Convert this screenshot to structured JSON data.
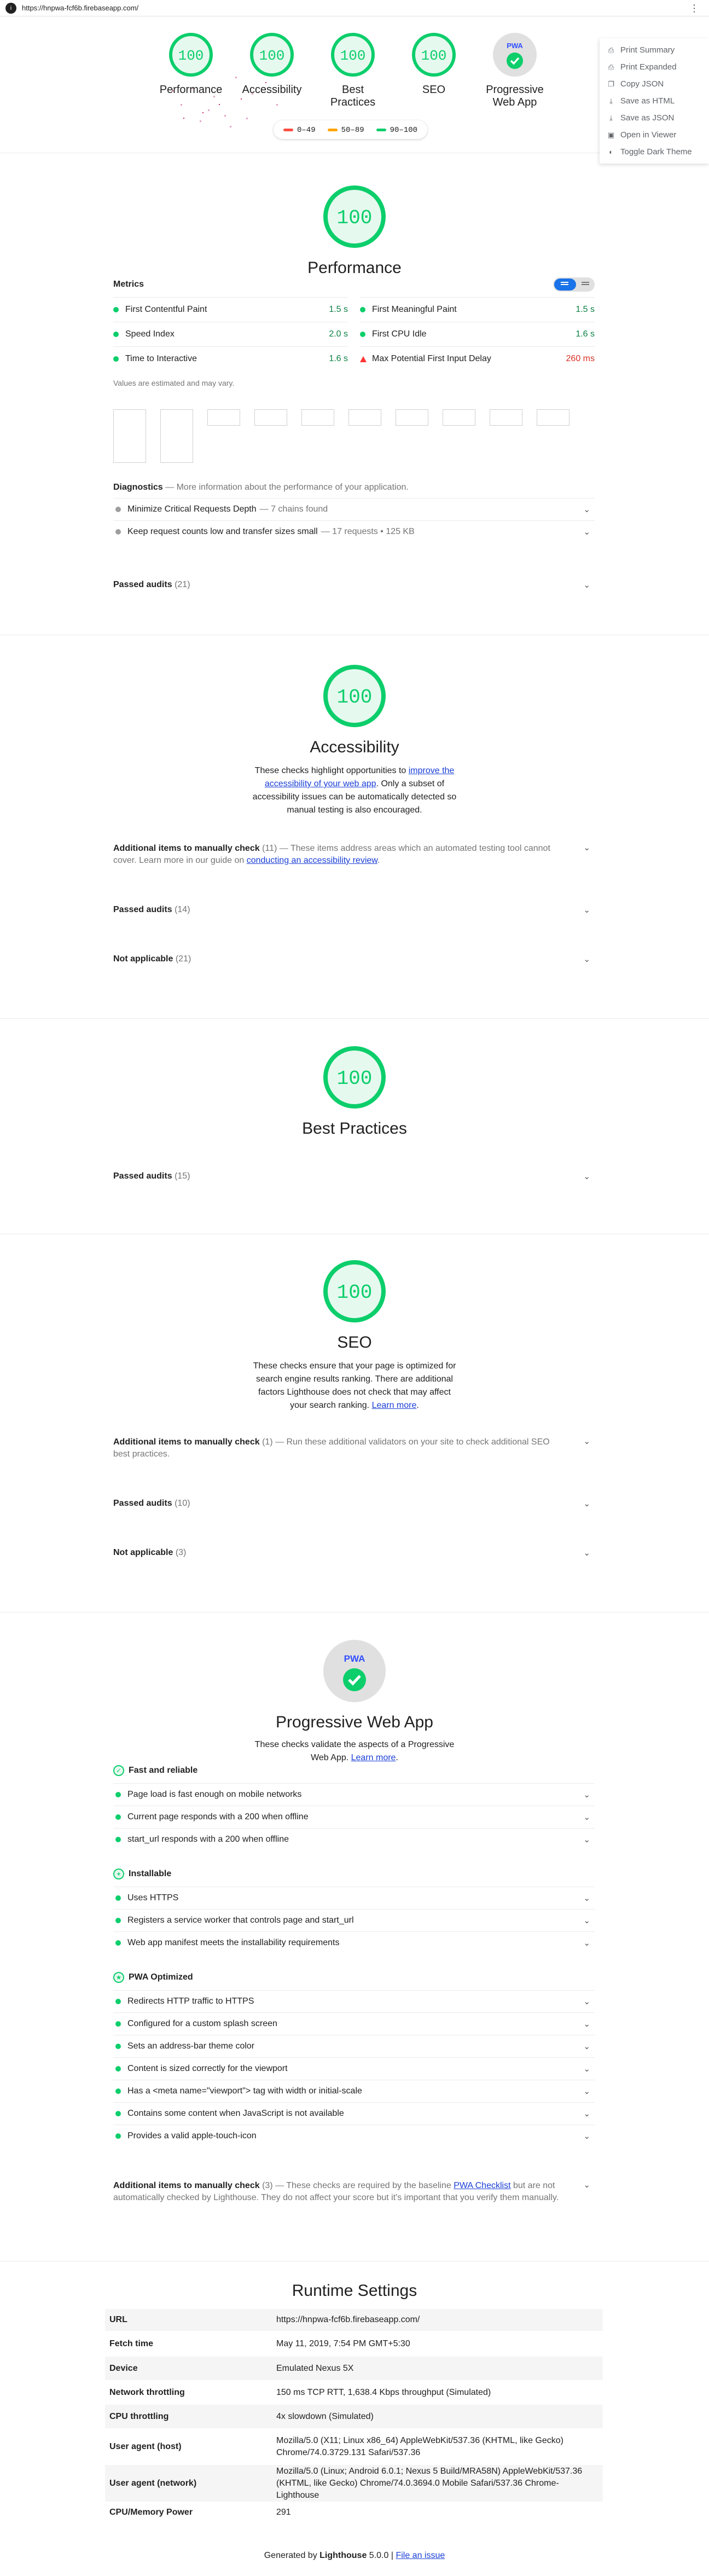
{
  "url_bar": {
    "url": "https://hnpwa-fcf6b.firebaseapp.com/",
    "logo_letter": "i"
  },
  "scores": [
    {
      "label": "Performance",
      "score": "100"
    },
    {
      "label": "Accessibility",
      "score": "100"
    },
    {
      "label": "Best Practices",
      "score": "100"
    },
    {
      "label": "SEO",
      "score": "100"
    },
    {
      "label": "Progressive Web App",
      "score": "PWA"
    }
  ],
  "legend": [
    {
      "range": "0–49",
      "color": "#ff4e42"
    },
    {
      "range": "50–89",
      "color": "#ffa400"
    },
    {
      "range": "90–100",
      "color": "#0cce6b"
    }
  ],
  "tools_menu": [
    {
      "label": "Print Summary",
      "icon": "print-icon"
    },
    {
      "label": "Print Expanded",
      "icon": "print-icon"
    },
    {
      "label": "Copy JSON",
      "icon": "copy-icon"
    },
    {
      "label": "Save as HTML",
      "icon": "download-icon"
    },
    {
      "label": "Save as JSON",
      "icon": "download-icon"
    },
    {
      "label": "Open in Viewer",
      "icon": "open-icon"
    },
    {
      "label": "Toggle Dark Theme",
      "icon": "dark-theme-icon"
    }
  ],
  "performance": {
    "score": "100",
    "title": "Performance",
    "metrics_title": "Metrics",
    "metrics": [
      {
        "label": "First Contentful Paint",
        "value": "1.5 s",
        "status": "pass"
      },
      {
        "label": "First Meaningful Paint",
        "value": "1.5 s",
        "status": "pass"
      },
      {
        "label": "Speed Index",
        "value": "2.0 s",
        "status": "pass"
      },
      {
        "label": "First CPU Idle",
        "value": "1.6 s",
        "status": "pass"
      },
      {
        "label": "Time to Interactive",
        "value": "1.6 s",
        "status": "pass"
      },
      {
        "label": "Max Potential First Input Delay",
        "value": "260 ms",
        "status": "fail"
      }
    ],
    "note": "Values are estimated and may vary.",
    "diagnostics_title": "Diagnostics",
    "diagnostics_desc": "— More information about the performance of your application.",
    "diagnostics": [
      {
        "label": "Minimize Critical Requests Depth",
        "sub": "— 7 chains found"
      },
      {
        "label": "Keep request counts low and transfer sizes small",
        "sub": "— 17 requests • 125 KB"
      }
    ],
    "passed": {
      "label": "Passed audits",
      "count": "(21)"
    }
  },
  "accessibility": {
    "score": "100",
    "title": "Accessibility",
    "desc_pre": "These checks highlight opportunities to ",
    "desc_link": "improve the accessibility of your web app",
    "desc_post": ". Only a subset of accessibility issues can be automatically detected so manual testing is also encouraged.",
    "manual_title": "Additional items to manually check",
    "manual_count": "(11)",
    "manual_desc": "— These items address areas which an automated testing tool cannot cover. Learn more in our guide on ",
    "manual_link": "conducting an accessibility review",
    "manual_end": ".",
    "passed": {
      "label": "Passed audits",
      "count": "(14)"
    },
    "na": {
      "label": "Not applicable",
      "count": "(21)"
    }
  },
  "best_practices": {
    "score": "100",
    "title": "Best Practices",
    "passed": {
      "label": "Passed audits",
      "count": "(15)"
    }
  },
  "seo": {
    "score": "100",
    "title": "SEO",
    "desc_pre": "These checks ensure that your page is optimized for search engine results ranking. There are additional factors Lighthouse does not check that may affect your search ranking. ",
    "desc_link": "Learn more",
    "desc_post": ".",
    "manual_title": "Additional items to manually check",
    "manual_count": "(1)",
    "manual_desc": "— Run these additional validators on your site to check additional SEO best practices.",
    "passed": {
      "label": "Passed audits",
      "count": "(10)"
    },
    "na": {
      "label": "Not applicable",
      "count": "(3)"
    }
  },
  "pwa": {
    "badge": "PWA",
    "title": "Progressive Web App",
    "desc_pre": "These checks validate the aspects of a Progressive Web App. ",
    "desc_link": "Learn more",
    "desc_post": ".",
    "groups": [
      {
        "title": "Fast and reliable",
        "items": [
          "Page load is fast enough on mobile networks",
          "Current page responds with a 200 when offline",
          "start_url responds with a 200 when offline"
        ]
      },
      {
        "title": "Installable",
        "items": [
          "Uses HTTPS",
          "Registers a service worker that controls page and start_url",
          "Web app manifest meets the installability requirements"
        ]
      },
      {
        "title": "PWA Optimized",
        "items": [
          "Redirects HTTP traffic to HTTPS",
          "Configured for a custom splash screen",
          "Sets an address-bar theme color",
          "Content is sized correctly for the viewport",
          "Has a <meta name=\"viewport\"> tag with width or initial-scale",
          "Contains some content when JavaScript is not available",
          "Provides a valid apple-touch-icon"
        ]
      }
    ],
    "manual_title": "Additional items to manually check",
    "manual_count": "(3)",
    "manual_desc": "— These checks are required by the baseline ",
    "manual_link": "PWA Checklist",
    "manual_end": " but are not automatically checked by Lighthouse. They do not affect your score but it's important that you verify them manually."
  },
  "runtime": {
    "title": "Runtime Settings",
    "rows": [
      {
        "k": "URL",
        "v": "https://hnpwa-fcf6b.firebaseapp.com/"
      },
      {
        "k": "Fetch time",
        "v": "May 11, 2019, 7:54 PM GMT+5:30"
      },
      {
        "k": "Device",
        "v": "Emulated Nexus 5X"
      },
      {
        "k": "Network throttling",
        "v": "150 ms TCP RTT, 1,638.4 Kbps throughput (Simulated)"
      },
      {
        "k": "CPU throttling",
        "v": "4x slowdown (Simulated)"
      },
      {
        "k": "User agent (host)",
        "v": "Mozilla/5.0 (X11; Linux x86_64) AppleWebKit/537.36 (KHTML, like Gecko) Chrome/74.0.3729.131 Safari/537.36"
      },
      {
        "k": "User agent (network)",
        "v": "Mozilla/5.0 (Linux; Android 6.0.1; Nexus 5 Build/MRA58N) AppleWebKit/537.36 (KHTML, like Gecko) Chrome/74.0.3694.0 Mobile Safari/537.36 Chrome-Lighthouse"
      },
      {
        "k": "CPU/Memory Power",
        "v": "291"
      }
    ]
  },
  "footer": {
    "pre": "Generated by ",
    "brand": "Lighthouse",
    "version": " 5.0.0 | ",
    "link": "File an issue"
  }
}
